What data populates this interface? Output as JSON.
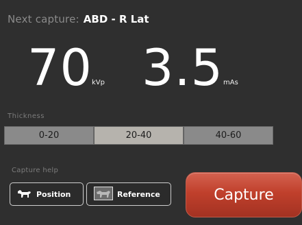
{
  "next_capture": {
    "label": "Next capture:",
    "value": "ABD - R Lat"
  },
  "exposure": {
    "kv": {
      "value": "70",
      "unit": "kVp"
    },
    "mas": {
      "value": "3.5",
      "unit": "mAs"
    }
  },
  "thickness": {
    "label": "Thickness",
    "options": [
      "0-20",
      "20-40",
      "40-60"
    ],
    "selected": "20-40"
  },
  "capture_help": {
    "label": "Capture help",
    "position_label": "Position",
    "position_icon": "dog-icon",
    "reference_label": "Reference",
    "reference_icon": "xray-thumbnail-icon"
  },
  "capture_button": {
    "label": "Capture",
    "color": "#c0402c"
  }
}
